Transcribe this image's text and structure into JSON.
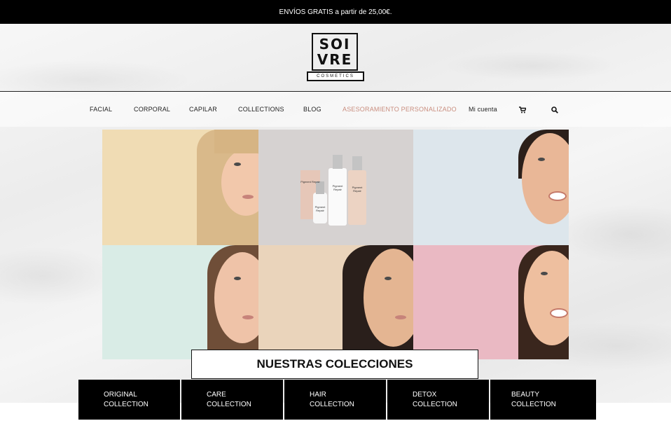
{
  "topbar": {
    "text": "ENVÍOS GRATIS a partir de 25,00€."
  },
  "logo": {
    "line1": "SOI",
    "line2": "VRE",
    "sub": "COSMETICS"
  },
  "nav": {
    "items": [
      {
        "label": "FACIAL"
      },
      {
        "label": "CORPORAL"
      },
      {
        "label": "CAPILAR"
      },
      {
        "label": "COLLECTIONS"
      },
      {
        "label": "BLOG"
      },
      {
        "label": "ASESORAMIENTO PERSONALIZADO",
        "accent": "#c98d7e"
      },
      {
        "label": "Mi cuenta"
      }
    ],
    "icons": [
      "cart-icon",
      "search-icon"
    ]
  },
  "hero": {
    "products": {
      "labels": [
        "Pigment Repair",
        "Pigment Repair",
        "Pigment Repair",
        "Pigment Repair"
      ]
    },
    "tile_colors": [
      "#f0dcb4",
      "#d6d2d1",
      "#dde6ec",
      "#d9ece6",
      "#ead4bb",
      "#eab9c3"
    ]
  },
  "collections": {
    "title": "NUESTRAS COLECCIONES",
    "items": [
      {
        "line1": "ORIGINAL",
        "line2": "COLLECTION"
      },
      {
        "line1": "CARE",
        "line2": "COLLECTION"
      },
      {
        "line1": "HAIR",
        "line2": "COLLECTION"
      },
      {
        "line1": "DETOX",
        "line2": "COLLECTION"
      },
      {
        "line1": "BEAUTY",
        "line2": "COLLECTION"
      }
    ]
  }
}
